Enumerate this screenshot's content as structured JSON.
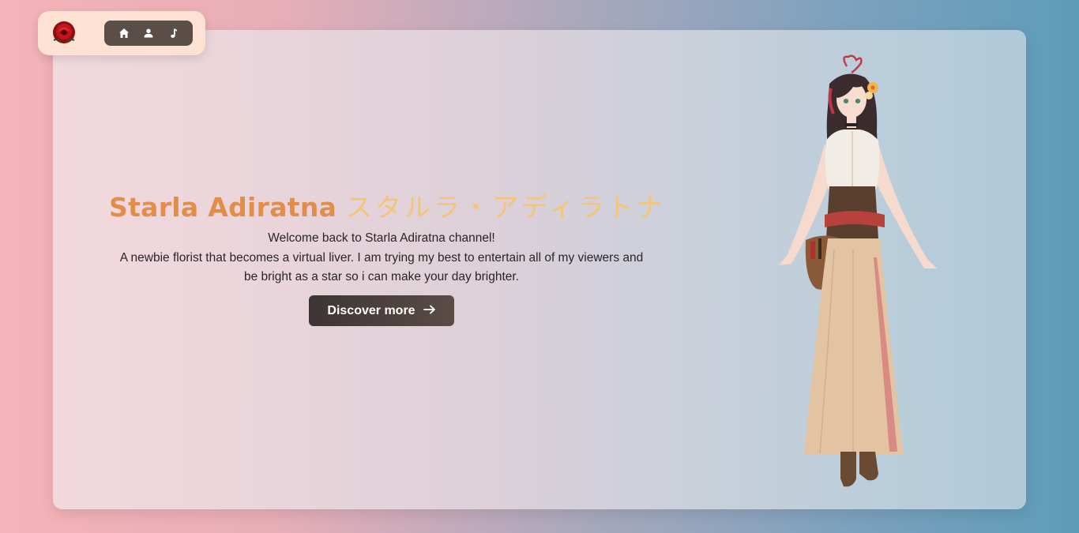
{
  "nav": {
    "logo_icon": "rose-icon",
    "items": [
      {
        "name": "home",
        "icon": "home-icon"
      },
      {
        "name": "about",
        "icon": "user-icon"
      },
      {
        "name": "music",
        "icon": "music-note-icon"
      }
    ]
  },
  "hero": {
    "title_latin": "Starla Adiratna",
    "title_jp": "スタルラ・アディラトナ",
    "line1": "Welcome back to Starla Adiratna channel!",
    "line2": "A newbie florist that becomes a virtual liver. I am trying my best to entertain all of my viewers and",
    "line3": "be bright as a star so i can make your day brighter.",
    "cta_label": "Discover more",
    "cta_icon": "arrow-right-icon"
  },
  "colors": {
    "title_latin": "#e38d4a",
    "title_jp": "#f5c575",
    "nav_bg": "#fde2d4",
    "nav_pill": "#5b4e49",
    "button_bg": "#3d3534"
  }
}
